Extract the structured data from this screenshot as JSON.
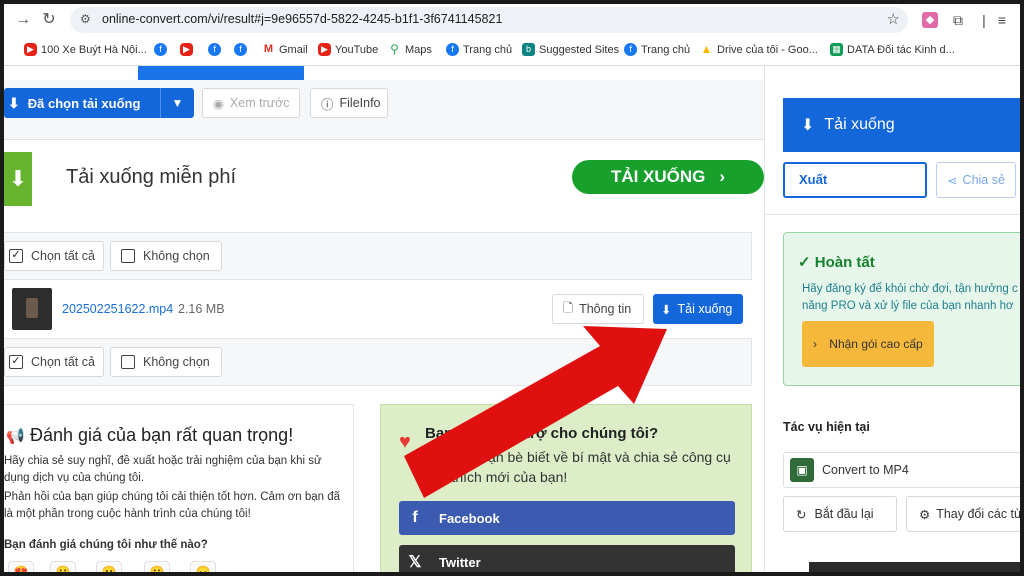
{
  "browser": {
    "url": "online-convert.com/vi/result#j=9e96557d-5822-4245-b1f1-3f6741145821",
    "bookmarks": [
      {
        "label": "100 Xe Buýt Hà Nội...",
        "icon": "youtube-icon"
      },
      {
        "label": "",
        "icon": "facebook-icon"
      },
      {
        "label": "",
        "icon": "youtube-icon"
      },
      {
        "label": "",
        "icon": "facebook-icon"
      },
      {
        "label": "",
        "icon": "facebook-icon"
      },
      {
        "label": "Gmail",
        "icon": "gmail-icon"
      },
      {
        "label": "YouTube",
        "icon": "youtube-icon"
      },
      {
        "label": "Maps",
        "icon": "maps-icon"
      },
      {
        "label": "Trang chủ",
        "icon": "facebook-icon"
      },
      {
        "label": "Suggested Sites",
        "icon": "bing-icon"
      },
      {
        "label": "Trang chủ",
        "icon": "facebook-icon"
      },
      {
        "label": "Drive của tôi - Goo...",
        "icon": "drive-icon"
      },
      {
        "label": "DATA Đối tác Kinh d...",
        "icon": "sheets-icon"
      }
    ]
  },
  "toolbar": {
    "download_selected": "Đã chọn tải xuống",
    "preview": "Xem trước",
    "fileinfo": "FileInfo"
  },
  "free": {
    "title": "Tải xuống miễn phí",
    "button": "TẢI XUỐNG"
  },
  "files": {
    "select_all": "Chọn tất cả",
    "select_none": "Không chọn",
    "items": [
      {
        "name": "202502251622.mp4",
        "size": "2.16 MB",
        "info": "Thông tin",
        "download": "Tải xuống"
      }
    ]
  },
  "rating": {
    "title": "Đánh giá của bạn rất quan trọng!",
    "p1": "Hãy chia sẻ suy nghĩ, đề xuất hoặc trải nghiệm của bạn khi sử dụng dịch vụ của chúng tôi.",
    "p2": "Phản hồi của bạn giúp chúng tôi cải thiện tốt hơn. Cảm ơn bạn đã là một phần trong cuộc hành trình của chúng tôi!",
    "question": "Bạn đánh giá chúng tôi như thế nào?"
  },
  "support": {
    "title": "Bạn muốn hỗ trợ cho chúng tôi?",
    "body": "Hãy cho bạn bè biết về bí mật và chia sẻ công cụ yêu thích mới của bạn!",
    "facebook": "Facebook",
    "twitter": "Twitter"
  },
  "sidebar": {
    "download": "Tải xuống",
    "export": "Xuất",
    "share": "Chia sẻ",
    "done_title": "Hoàn tất",
    "done_line1": "Hãy đăng ký để khỏi chờ đợi, tận hưởng c",
    "done_line2": "năng PRO và xử lý file của bạn nhanh hơ",
    "upgrade": "Nhận gói cao cấp",
    "task_title": "Tác vụ hiện tại",
    "task": "Convert to MP4",
    "restart": "Bắt đầu lại",
    "change": "Thay đổi các tù"
  },
  "colors": {
    "primary": "#1466db",
    "green": "#17a02b",
    "annotation": "#e01010"
  }
}
